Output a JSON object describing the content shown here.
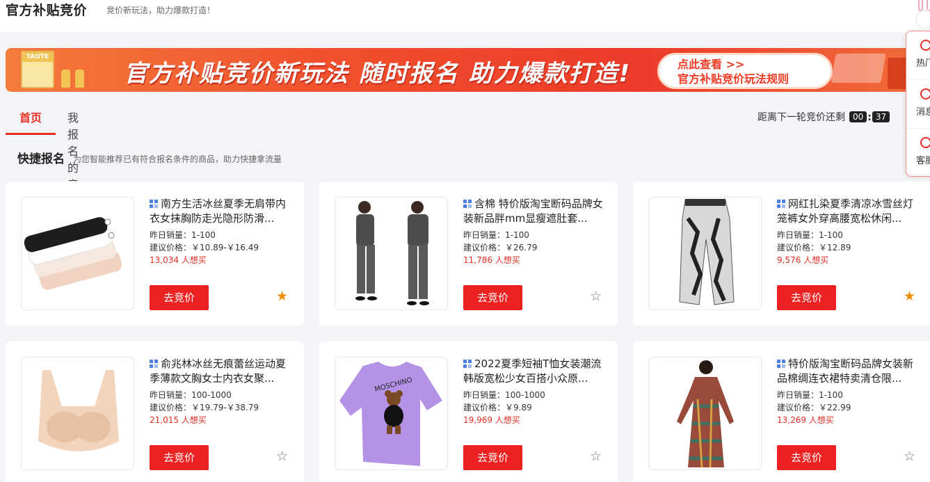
{
  "header": {
    "title": "官方补贴竞价",
    "subtitle": "竞价新玩法，助力爆款打造！"
  },
  "banner": {
    "tag": "TAOTE",
    "headline": "官方补贴竞价新玩法 随时报名 助力爆款打造!",
    "cta_line1": "点此查看 >>",
    "cta_line2": "官方补贴竞价玩法规则"
  },
  "tabs": [
    {
      "label": "首页",
      "active": true
    },
    {
      "label": "我报名的竞价",
      "active": false
    }
  ],
  "countdown": {
    "label": "距离下一轮竞价还剩",
    "hours": "00",
    "minutes": "37"
  },
  "quick": {
    "title": "快捷报名",
    "subtitle": "为您智能推荐已有符合报名条件的商品，助力快捷拿流量"
  },
  "products": [
    {
      "name": "南方生活冰丝夏季无肩带内衣女抹胸防走光隐形防滑...",
      "sales": "昨日销量：1-100",
      "price": "建议价格：￥10.89-￥16.49",
      "want": "13,034 人想买",
      "button": "去竞价",
      "starred": true,
      "star_on": "★",
      "star_off": "☆"
    },
    {
      "name": "含棉 特价版淘宝断码品牌女装新品胖mm显瘦遮肚套...",
      "sales": "昨日销量：1-100",
      "price": "建议价格：￥26.79",
      "want": "11,786 人想买",
      "button": "去竞价",
      "starred": false,
      "star_on": "★",
      "star_off": "☆"
    },
    {
      "name": "网红扎染夏季清凉冰雪丝灯笼裤女外穿高腰宽松休闲...",
      "sales": "昨日销量：1-100",
      "price": "建议价格：￥12.89",
      "want": "9,576 人想买",
      "button": "去竞价",
      "starred": true,
      "star_on": "★",
      "star_off": "☆"
    },
    {
      "name": "俞兆林冰丝无痕蕾丝运动夏季薄款文胸女士内衣女聚...",
      "sales": "昨日销量：100-1000",
      "price": "建议价格：￥19.79-￥38.79",
      "want": "21,015 人想买",
      "button": "去竞价",
      "starred": false,
      "star_on": "★",
      "star_off": "☆"
    },
    {
      "name": "2022夏季短袖T恤女装潮流韩版宽松少女百搭小众原...",
      "sales": "昨日销量：100-1000",
      "price": "建议价格：￥9.89",
      "want": "19,969 人想买",
      "button": "去竞价",
      "starred": false,
      "star_on": "★",
      "star_off": "☆",
      "tshirt_text": "MOSCHINO"
    },
    {
      "name": "特价版淘宝断码品牌女装新品棉绸连衣裙特卖清仓限...",
      "sales": "昨日销量：1-100",
      "price": "建议价格：￥22.99",
      "want": "13,269 人想买",
      "button": "去竞价",
      "starred": false,
      "star_on": "★",
      "star_off": "☆"
    }
  ],
  "side_panel": {
    "items": [
      {
        "label": "热门",
        "icon": "fire-icon"
      },
      {
        "label": "消息",
        "icon": "bell-icon"
      },
      {
        "label": "客服",
        "icon": "headset-icon"
      }
    ]
  },
  "colors": {
    "accent": "#e62d22",
    "button": "#ec2121",
    "star_on": "#f08c00"
  }
}
